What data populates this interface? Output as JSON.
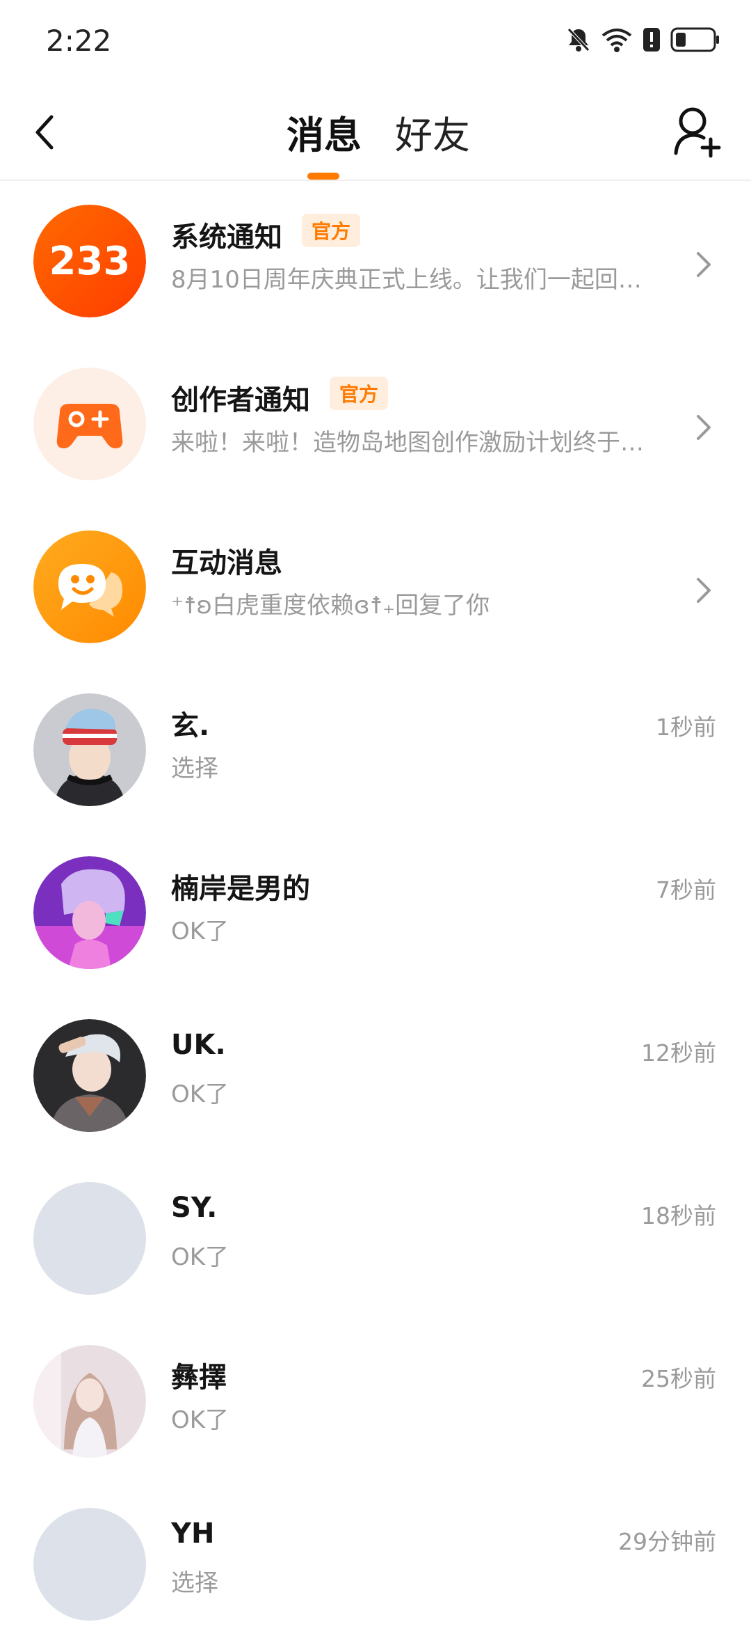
{
  "status_bar": {
    "time": "2:22"
  },
  "header": {
    "tabs": [
      {
        "label": "消息",
        "active": true
      },
      {
        "label": "好友",
        "active": false
      }
    ],
    "accent_color": "#ff7a00"
  },
  "conversations": [
    {
      "name": "系统通知",
      "badge": "官方",
      "preview": "8月10日周年庆典正式上线。让我们一起回…",
      "avatar": "logo-233",
      "has_chevron": true
    },
    {
      "name": "创作者通知",
      "badge": "官方",
      "preview": "来啦！来啦！造物岛地图创作激励计划终于…",
      "avatar": "gamepad-icon",
      "has_chevron": true
    },
    {
      "name": "互动消息",
      "preview": "⁺☨ʚ白虎重度依赖ɞ☨₊回复了你",
      "avatar": "chat-smile-icon",
      "has_chevron": true
    },
    {
      "name": "玄.",
      "preview": "选择",
      "time": "1秒前",
      "avatar": "user-photo"
    },
    {
      "name": "楠岸是男的",
      "preview": "OK了",
      "time": "7秒前",
      "avatar": "user-photo"
    },
    {
      "name": "UK.",
      "preview": "OK了",
      "time": "12秒前",
      "avatar": "user-photo"
    },
    {
      "name": "SY.",
      "preview": "OK了",
      "time": "18秒前",
      "avatar": "default-avatar"
    },
    {
      "name": "彝擇",
      "preview": "OK了",
      "time": "25秒前",
      "avatar": "user-photo"
    },
    {
      "name": "YH",
      "preview": "选择",
      "time": "29分钟前",
      "avatar": "default-avatar"
    }
  ]
}
